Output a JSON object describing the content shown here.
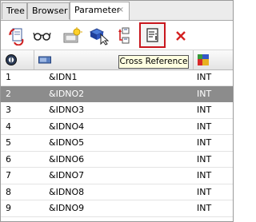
{
  "tabs": [
    {
      "label": "Tree"
    },
    {
      "label": "Browser"
    },
    {
      "label": "Parameter",
      "close": "×"
    }
  ],
  "toolbar": {
    "buttons": [
      "refresh-icon",
      "glasses-icon",
      "new-parameter-icon",
      "select-icon",
      "tree-icon",
      "cross-reference-icon",
      "delete-icon"
    ],
    "tooltip": "Cross Reference"
  },
  "table": {
    "header_icons": [
      "id-icon",
      "name-field-icon",
      "type-icon"
    ],
    "rows": [
      {
        "id": "1",
        "name": "&IDN1",
        "type": "INT"
      },
      {
        "id": "2",
        "name": "&IDNO2",
        "type": "INT"
      },
      {
        "id": "3",
        "name": "&IDNO3",
        "type": "INT"
      },
      {
        "id": "4",
        "name": "&IDNO4",
        "type": "INT"
      },
      {
        "id": "5",
        "name": "&IDNO5",
        "type": "INT"
      },
      {
        "id": "6",
        "name": "&IDNO6",
        "type": "INT"
      },
      {
        "id": "7",
        "name": "&IDNO7",
        "type": "INT"
      },
      {
        "id": "8",
        "name": "&IDNO8",
        "type": "INT"
      },
      {
        "id": "9",
        "name": "&IDNO9",
        "type": "INT"
      }
    ],
    "selected_row": "2"
  },
  "colors": {
    "highlight_border": "#c8161d",
    "selected_row": "#8c8c8c",
    "tooltip_bg": "#ffffe1"
  }
}
